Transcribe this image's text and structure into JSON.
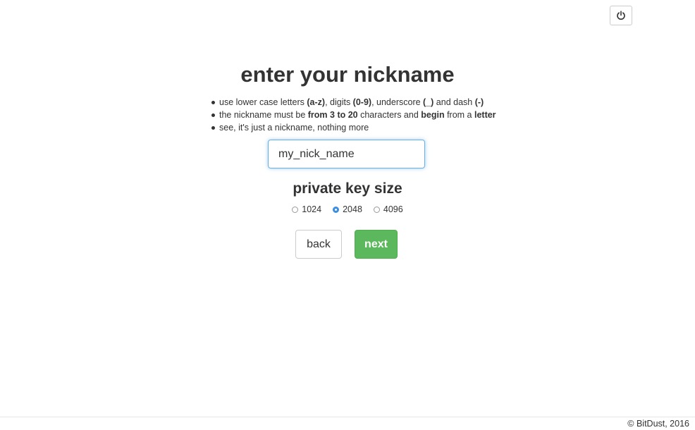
{
  "header": {
    "power_icon": "power-icon"
  },
  "title": "enter your nickname",
  "rules": [
    {
      "parts": [
        {
          "t": "use lower case letters "
        },
        {
          "b": "(a-z)"
        },
        {
          "t": ", digits "
        },
        {
          "b": "(0-9)"
        },
        {
          "t": ", underscore "
        },
        {
          "b": "(_)"
        },
        {
          "t": " and dash "
        },
        {
          "b": "(-)"
        }
      ]
    },
    {
      "parts": [
        {
          "t": "the nickname must be "
        },
        {
          "b": "from 3 to 20"
        },
        {
          "t": " characters and "
        },
        {
          "b": "begin"
        },
        {
          "t": " from a "
        },
        {
          "b": "letter"
        }
      ]
    },
    {
      "parts": [
        {
          "t": "see, it's just a nickname, nothing more"
        }
      ]
    }
  ],
  "nickname": {
    "value": "my_nick_name"
  },
  "key_size": {
    "title": "private key size",
    "options": [
      "1024",
      "2048",
      "4096"
    ],
    "selected": "2048"
  },
  "buttons": {
    "back": "back",
    "next": "next"
  },
  "colors": {
    "next_bg": "#5cb85c",
    "focus_border": "#66afe9",
    "radio_checked": "#3b8ee0"
  },
  "footer": "© BitDust, 2016"
}
